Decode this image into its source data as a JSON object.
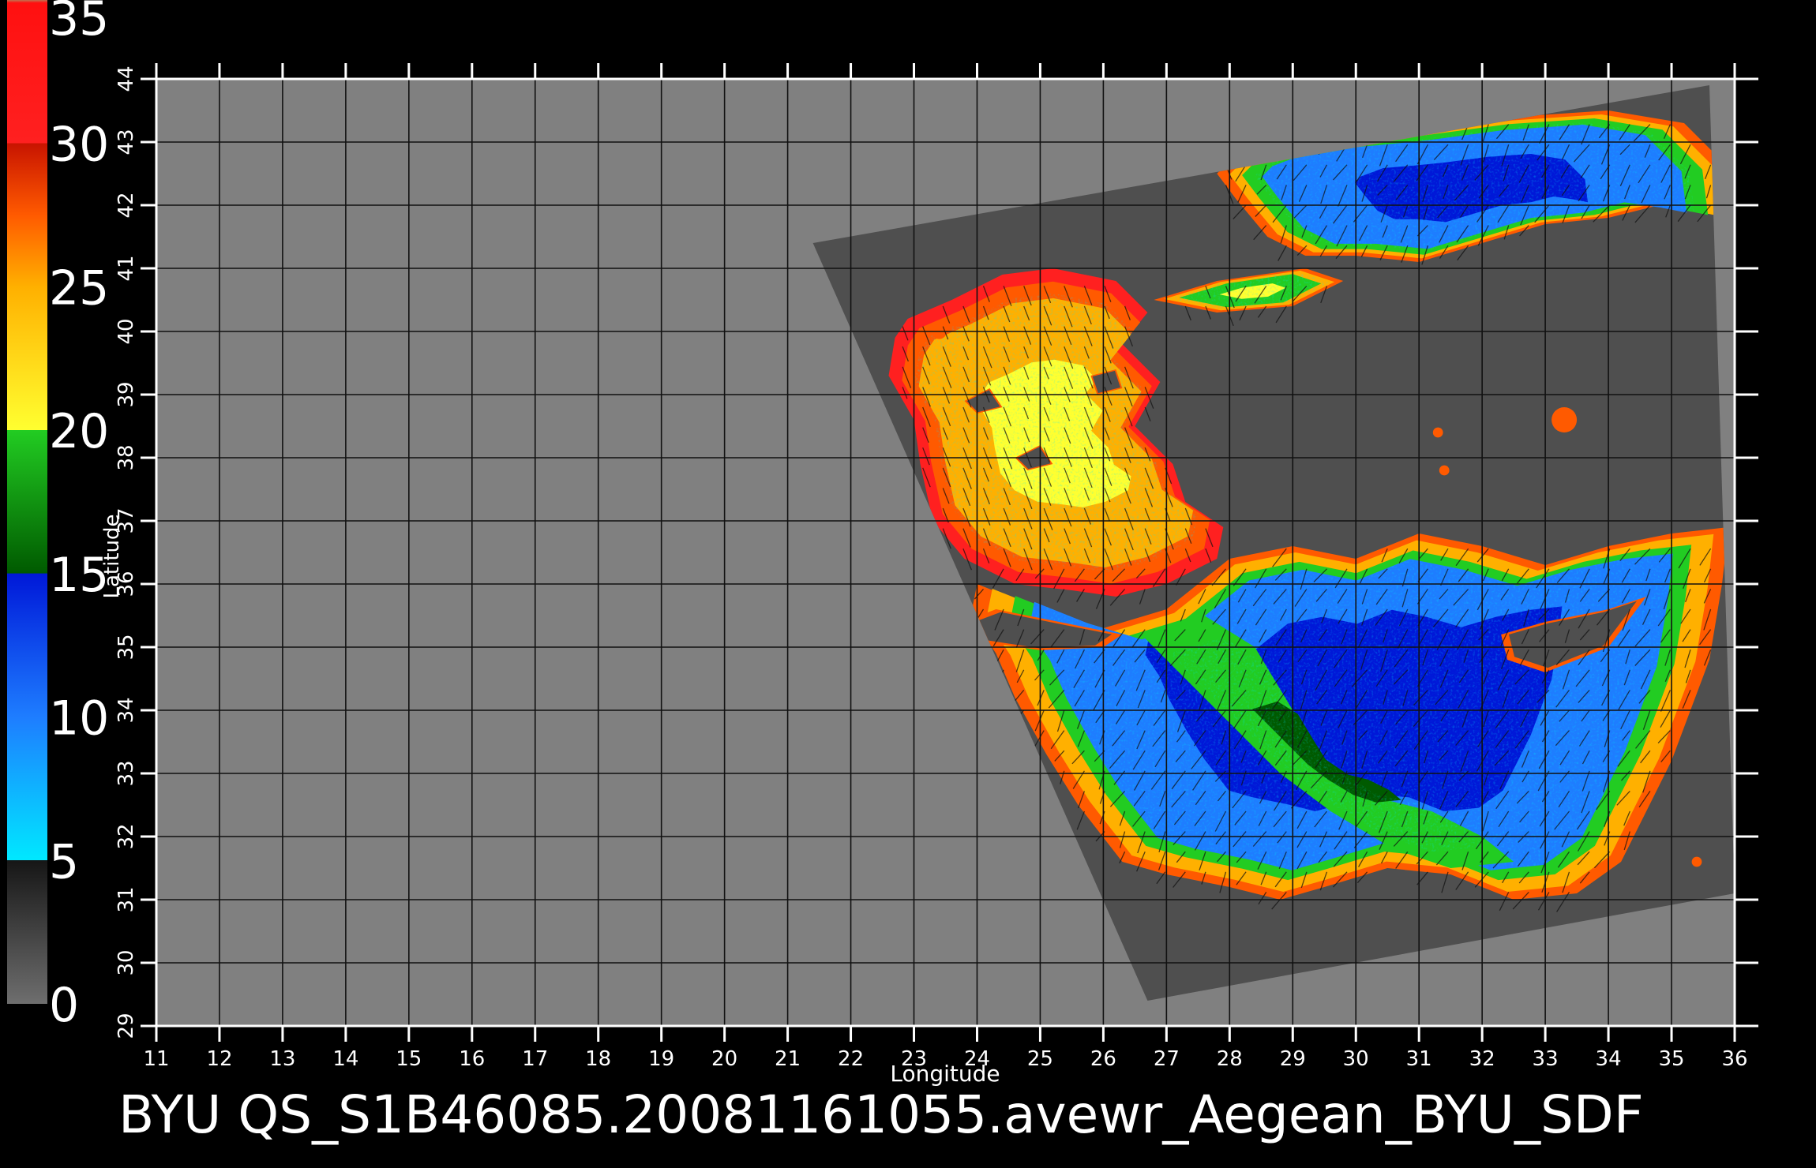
{
  "title": "BYU  QS_S1B46085.20081161055.avewr_Aegean_BYU_SDF",
  "colorbar": {
    "labels": [
      "0",
      "5",
      "10",
      "15",
      "20",
      "25",
      "30",
      "35"
    ],
    "range": [
      0,
      35
    ],
    "stops": [
      {
        "value": 0,
        "color": "#6e6e6e"
      },
      {
        "value": 5,
        "color": "#161616"
      },
      {
        "value": 5.01,
        "color": "#00e8ff"
      },
      {
        "value": 10,
        "color": "#1e7dff"
      },
      {
        "value": 15,
        "color": "#0018d8"
      },
      {
        "value": 15.01,
        "color": "#005a00"
      },
      {
        "value": 20,
        "color": "#22cc22"
      },
      {
        "value": 20.01,
        "color": "#ffff30"
      },
      {
        "value": 25,
        "color": "#ffb000"
      },
      {
        "value": 27.5,
        "color": "#ff5a00"
      },
      {
        "value": 30,
        "color": "#c81400"
      },
      {
        "value": 30.01,
        "color": "#ff2020"
      },
      {
        "value": 34.9,
        "color": "#ff1010"
      },
      {
        "value": 35,
        "color": "#c07050"
      }
    ]
  },
  "map": {
    "x_axis_label": "Longitude",
    "y_axis_label": "Latitude",
    "lon_range": [
      11,
      36
    ],
    "lat_range": [
      29,
      44
    ],
    "lon_ticks": [
      "11",
      "12",
      "13",
      "14",
      "15",
      "16",
      "17",
      "18",
      "19",
      "20",
      "21",
      "22",
      "23",
      "24",
      "25",
      "26",
      "27",
      "28",
      "29",
      "30",
      "31",
      "32",
      "33",
      "34",
      "35",
      "36"
    ],
    "lat_ticks": [
      "29",
      "30",
      "31",
      "32",
      "33",
      "34",
      "35",
      "36",
      "37",
      "38",
      "39",
      "40",
      "41",
      "42",
      "43",
      "44"
    ],
    "grid": true,
    "colors": {
      "background": "#000000",
      "no_data": "#808080",
      "swath_land": "#4f4f4f",
      "grid": "#111111",
      "frame": "#ffffff"
    },
    "swath_corners": [
      [
        21.4,
        41.4
      ],
      [
        35.6,
        43.9
      ],
      [
        36.0,
        31.1
      ],
      [
        26.7,
        29.4
      ]
    ],
    "wind_regions": [
      {
        "name": "black-sea",
        "polygon": [
          [
            28.0,
            42.7
          ],
          [
            28.8,
            43.0
          ],
          [
            30.0,
            43.1
          ],
          [
            31.0,
            43.2
          ],
          [
            32.5,
            43.4
          ],
          [
            34.0,
            43.5
          ],
          [
            35.2,
            43.3
          ],
          [
            35.9,
            42.6
          ],
          [
            36.0,
            41.8
          ],
          [
            35.5,
            41.9
          ],
          [
            34.8,
            42.0
          ],
          [
            34.0,
            41.8
          ],
          [
            33.0,
            41.7
          ],
          [
            32.0,
            41.4
          ],
          [
            31.0,
            41.1
          ],
          [
            30.0,
            41.2
          ],
          [
            29.2,
            41.2
          ],
          [
            28.6,
            41.5
          ],
          [
            28.1,
            42.1
          ],
          [
            27.8,
            42.5
          ]
        ],
        "layers": [
          [
            "#ff5a00",
            1.0
          ],
          [
            "#ffb000",
            0.95
          ],
          [
            "#22cc22",
            0.9
          ],
          [
            "#1e7dff",
            0.82
          ],
          [
            "#0018d8",
            0.45
          ]
        ]
      },
      {
        "name": "aegean",
        "polygon": [
          [
            22.9,
            40.2
          ],
          [
            23.6,
            40.5
          ],
          [
            24.4,
            40.9
          ],
          [
            25.2,
            41.0
          ],
          [
            26.2,
            40.8
          ],
          [
            26.7,
            40.3
          ],
          [
            26.3,
            39.8
          ],
          [
            26.9,
            39.2
          ],
          [
            26.5,
            38.5
          ],
          [
            27.1,
            37.9
          ],
          [
            27.3,
            37.3
          ],
          [
            27.9,
            36.9
          ],
          [
            27.8,
            36.4
          ],
          [
            27.0,
            36.0
          ],
          [
            26.2,
            35.8
          ],
          [
            25.5,
            35.9
          ],
          [
            24.6,
            36.0
          ],
          [
            23.8,
            36.4
          ],
          [
            23.3,
            37.0
          ],
          [
            23.1,
            37.9
          ],
          [
            23.0,
            38.6
          ],
          [
            22.6,
            39.3
          ],
          [
            22.7,
            39.9
          ]
        ],
        "layers": [
          [
            "#ff2020",
            1.0
          ],
          [
            "#ff5a00",
            0.92
          ],
          [
            "#ffb000",
            0.82
          ],
          [
            "#ffff30",
            0.45
          ]
        ]
      },
      {
        "name": "marmara",
        "polygon": [
          [
            26.8,
            40.5
          ],
          [
            27.8,
            40.8
          ],
          [
            29.2,
            41.0
          ],
          [
            29.8,
            40.8
          ],
          [
            29.0,
            40.4
          ],
          [
            27.8,
            40.3
          ]
        ],
        "layers": [
          [
            "#ff5a00",
            1.0
          ],
          [
            "#ffb000",
            0.9
          ],
          [
            "#22cc22",
            0.75
          ],
          [
            "#ffff30",
            0.35
          ]
        ]
      },
      {
        "name": "levantine",
        "polygon": [
          [
            24.0,
            36.0
          ],
          [
            25.0,
            35.6
          ],
          [
            26.0,
            35.3
          ],
          [
            27.0,
            35.6
          ],
          [
            28.0,
            36.4
          ],
          [
            29.0,
            36.6
          ],
          [
            30.0,
            36.4
          ],
          [
            31.0,
            36.8
          ],
          [
            32.0,
            36.6
          ],
          [
            33.0,
            36.3
          ],
          [
            34.0,
            36.6
          ],
          [
            35.0,
            36.8
          ],
          [
            35.9,
            36.9
          ],
          [
            35.8,
            36.0
          ],
          [
            35.6,
            34.8
          ],
          [
            35.3,
            34.0
          ],
          [
            35.0,
            33.2
          ],
          [
            34.6,
            32.4
          ],
          [
            34.2,
            31.6
          ],
          [
            33.5,
            31.1
          ],
          [
            32.5,
            31.0
          ],
          [
            31.5,
            31.4
          ],
          [
            30.5,
            31.5
          ],
          [
            29.5,
            31.2
          ],
          [
            28.8,
            31.0
          ],
          [
            28.0,
            31.2
          ],
          [
            27.0,
            31.4
          ],
          [
            26.3,
            31.6
          ],
          [
            25.6,
            32.5
          ],
          [
            25.1,
            33.3
          ],
          [
            24.6,
            34.2
          ],
          [
            24.3,
            34.9
          ],
          [
            23.9,
            35.5
          ]
        ],
        "layers": [
          [
            "#ff5a00",
            1.0
          ],
          [
            "#ffb000",
            0.96
          ],
          [
            "#22cc22",
            0.9
          ],
          [
            "#1e7dff",
            0.85
          ],
          [
            "#0018d8",
            0.55
          ]
        ]
      },
      {
        "name": "central-green-band",
        "polygon": [
          [
            26.6,
            35.2
          ],
          [
            27.6,
            35.5
          ],
          [
            28.4,
            35.0
          ],
          [
            29.0,
            34.0
          ],
          [
            29.5,
            33.2
          ],
          [
            30.4,
            32.6
          ],
          [
            31.2,
            32.4
          ],
          [
            32.0,
            32.0
          ],
          [
            32.5,
            31.6
          ],
          [
            31.5,
            31.5
          ],
          [
            30.6,
            31.8
          ],
          [
            29.6,
            32.4
          ],
          [
            28.8,
            33.0
          ],
          [
            28.0,
            33.8
          ],
          [
            27.3,
            34.5
          ]
        ],
        "layers": [
          [
            "#22cc22",
            1.0
          ],
          [
            "#005a00",
            0.4
          ]
        ]
      }
    ],
    "land_holes": [
      {
        "name": "crete",
        "polygon": [
          [
            23.5,
            35.3
          ],
          [
            24.3,
            35.6
          ],
          [
            25.3,
            35.4
          ],
          [
            26.3,
            35.2
          ],
          [
            26.0,
            35.0
          ],
          [
            25.0,
            34.95
          ],
          [
            24.0,
            35.1
          ]
        ]
      },
      {
        "name": "cyprus",
        "polygon": [
          [
            32.3,
            35.2
          ],
          [
            33.0,
            35.4
          ],
          [
            34.0,
            35.6
          ],
          [
            34.6,
            35.8
          ],
          [
            34.0,
            35.0
          ],
          [
            33.0,
            34.6
          ],
          [
            32.4,
            34.8
          ]
        ]
      },
      {
        "name": "aegean-island-1",
        "polygon": [
          [
            24.6,
            38.0
          ],
          [
            25.0,
            38.2
          ],
          [
            25.2,
            37.9
          ],
          [
            24.8,
            37.8
          ]
        ]
      },
      {
        "name": "aegean-island-2",
        "polygon": [
          [
            25.8,
            39.3
          ],
          [
            26.2,
            39.4
          ],
          [
            26.3,
            39.1
          ],
          [
            25.9,
            39.0
          ]
        ]
      },
      {
        "name": "aegean-island-3",
        "polygon": [
          [
            23.8,
            38.9
          ],
          [
            24.2,
            39.1
          ],
          [
            24.4,
            38.8
          ],
          [
            24.0,
            38.7
          ]
        ]
      }
    ],
    "speckles": [
      {
        "lon": 33.3,
        "lat": 38.6,
        "r": 0.2
      },
      {
        "lon": 31.3,
        "lat": 38.4,
        "r": 0.08
      },
      {
        "lon": 31.4,
        "lat": 37.8,
        "r": 0.08
      },
      {
        "lon": 35.4,
        "lat": 31.6,
        "r": 0.08
      },
      {
        "lon": 23.4,
        "lat": 40.0,
        "r": 0.12
      }
    ]
  }
}
